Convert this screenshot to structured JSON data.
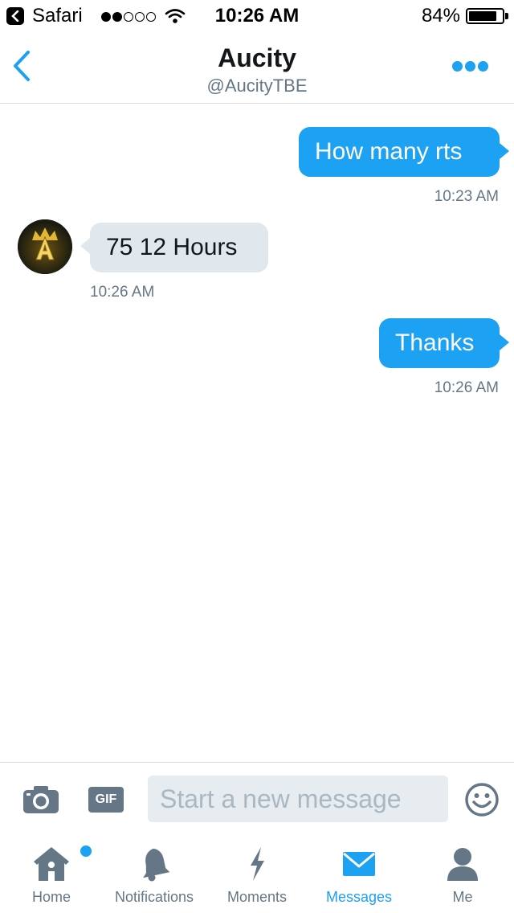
{
  "status_bar": {
    "back_app": "Safari",
    "signal_dots": 5,
    "signal_filled": 2,
    "time": "10:26 AM",
    "battery_text": "84%",
    "battery_level": 0.84
  },
  "header": {
    "title": "Aucity",
    "subtitle": "@AucityTBE"
  },
  "messages": [
    {
      "direction": "outgoing",
      "text": "How many rts",
      "time": "10:23 AM"
    },
    {
      "direction": "incoming",
      "text": "75 12 Hours",
      "time": "10:26 AM"
    },
    {
      "direction": "outgoing",
      "text": "Thanks",
      "time": "10:26 AM"
    }
  ],
  "compose": {
    "gif_label": "GIF",
    "placeholder": "Start a new message",
    "value": ""
  },
  "tabs": [
    {
      "label": "Home",
      "icon": "home-icon",
      "has_badge": true
    },
    {
      "label": "Notifications",
      "icon": "bell-icon"
    },
    {
      "label": "Moments",
      "icon": "lightning-icon"
    },
    {
      "label": "Messages",
      "icon": "envelope-icon",
      "active": true
    },
    {
      "label": "Me",
      "icon": "person-icon"
    }
  ],
  "colors": {
    "accent": "#1da1f2",
    "incoming_bubble": "#e1e8ed",
    "muted_text": "#657786",
    "placeholder": "#aab8c2"
  }
}
